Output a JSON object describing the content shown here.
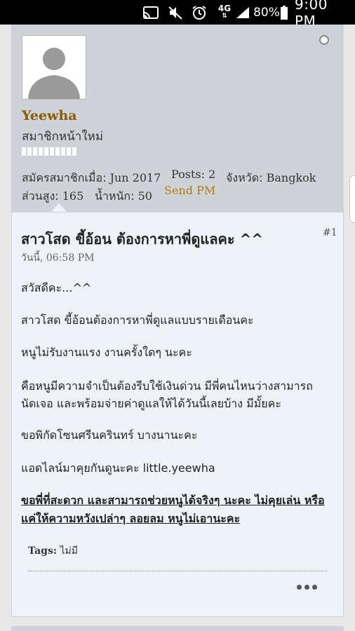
{
  "statusbar": {
    "network_type": "4G",
    "battery_percent": "80%",
    "time": "9:00 PM",
    "icons": [
      "cast-icon",
      "mute-icon",
      "alarm-icon",
      "network-arrows-icon",
      "signal-icon",
      "battery-icon"
    ]
  },
  "profile": {
    "username": "Yeewha",
    "rank": "สมาชิกหน้าใหม่",
    "rank_bar_segments": 10,
    "join_label": "สมัครสมาชิกเมื่อ:",
    "join_value": "Jun 2017",
    "posts_label": "Posts:",
    "posts_value": "2",
    "province_label": "จังหวัด:",
    "province_value": "Bangkok",
    "height_label": "ส่วนสูง:",
    "height_value": "165",
    "weight_label": "น้ำหนัก:",
    "weight_value": "50",
    "send_pm": "Send PM"
  },
  "post": {
    "title": "สาวโสด ขี้อ้อน ต้องการหาพี่ดูแลคะ ^^",
    "number": "#1",
    "date": "วันนี้, 06:58 PM",
    "paragraphs": [
      [
        "สวัสดีคะ...^^"
      ],
      [
        "สาวโสด ขี้อ้อนต้องการหาพี่ดูแลแบบรายเดือนคะ"
      ],
      [
        "หนูไม่รับงานแรง งานครั้งใดๆ นะคะ"
      ],
      [
        "คือหนูมีความจำเป็นต้องรีบใช้เงินด่วน มีพี่คนไหนว่างสามารถ",
        "นัดเจอ และพร้อมจ่ายค่าดูแลให้ได้วันนี้เลยบ้าง มีมั้ยคะ"
      ],
      [
        "ขอพิกัดโซนศรีนครินทร์ บางนานะคะ"
      ],
      [
        "แอดไลน์มาคุยกันดูนะคะ little.yeewha"
      ]
    ],
    "emphasis_lines": [
      "ขอพี่ที่สะดวก และสามารถช่วยหนูได้จริงๆ นะคะ ไม่คุยเล่น หรือ",
      "แค่ให้ความหวังเปล่าๆ ลอยลม หนูไม่เอานะคะ"
    ],
    "tags_label": "Tags:",
    "tags_value": "ไม่มี"
  }
}
